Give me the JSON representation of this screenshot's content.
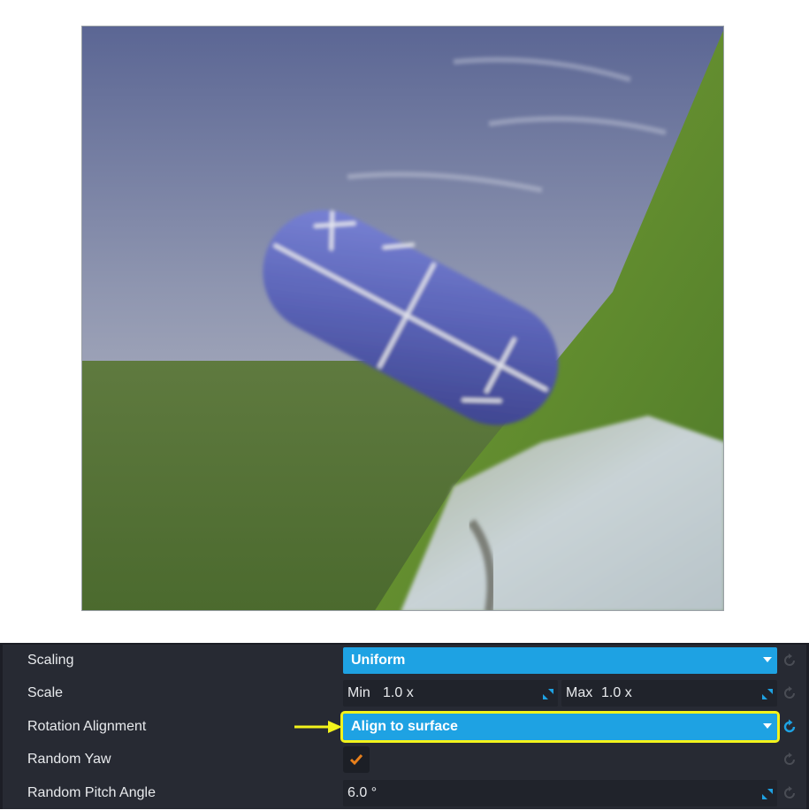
{
  "properties": {
    "scaling": {
      "label": "Scaling",
      "value": "Uniform"
    },
    "scale": {
      "label": "Scale",
      "min_label": "Min",
      "min_value": "1.0 x",
      "max_label": "Max",
      "max_value": "1.0 x"
    },
    "rotation_alignment": {
      "label": "Rotation Alignment",
      "value": "Align to surface"
    },
    "random_yaw": {
      "label": "Random Yaw",
      "checked": true
    },
    "random_pitch_angle": {
      "label": "Random Pitch Angle",
      "value": "6.0 °"
    }
  },
  "colors": {
    "panel_bg": "#272a33",
    "dropdown_bg": "#1ea2e3",
    "highlight": "#f3f31b",
    "check": "#e8801c",
    "active_reset": "#1ea2e3",
    "inactive_reset": "#4a4d55"
  }
}
